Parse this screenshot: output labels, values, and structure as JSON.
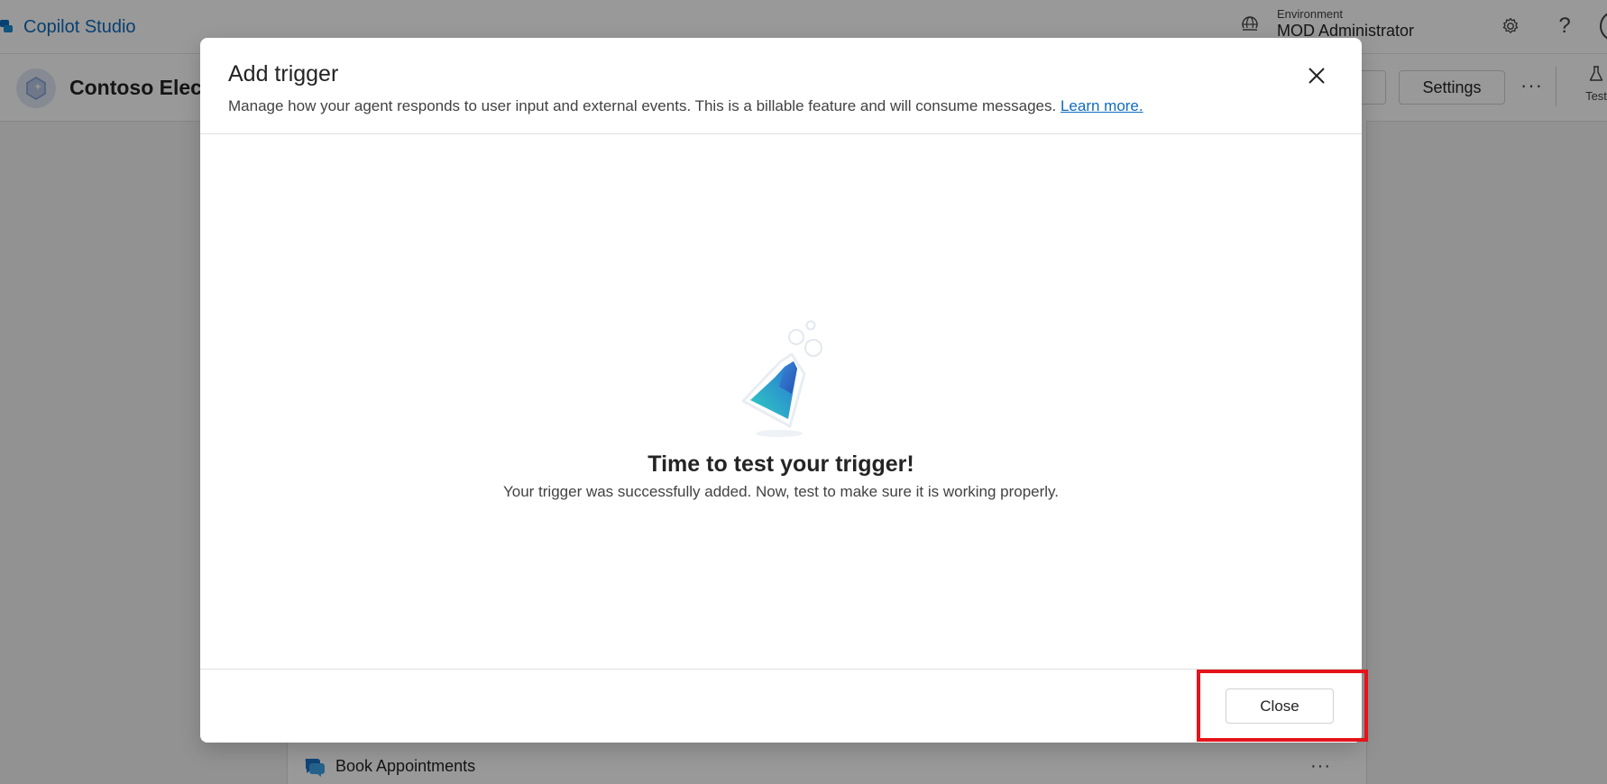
{
  "app": {
    "title": "Copilot Studio",
    "brand_color": "#0f6cbd"
  },
  "environment": {
    "label": "Environment",
    "value": "MOD Administrator",
    "icon": "environment-globe-icon"
  },
  "topbar_icons": {
    "settings": "gear-icon",
    "help": "?"
  },
  "agent": {
    "name": "Contoso Elect",
    "icon": "agent-hexagon-icon"
  },
  "subbar": {
    "settings_label": "Settings",
    "more_label": "···",
    "test_label": "Test"
  },
  "background": {
    "topic_label": "Book Appointments",
    "topic_more": "···"
  },
  "dialog": {
    "title": "Add trigger",
    "description": "Manage how your agent responds to user input and external events. This is a billable feature and will consume messages.",
    "learn_more": "Learn more.",
    "body_title": "Time to test your trigger!",
    "body_subtitle": "Your trigger was successfully added. Now, test to make sure it is working properly.",
    "close_button": "Close",
    "illustration": "test-flask-icon"
  },
  "highlight_color": "#e4141b"
}
